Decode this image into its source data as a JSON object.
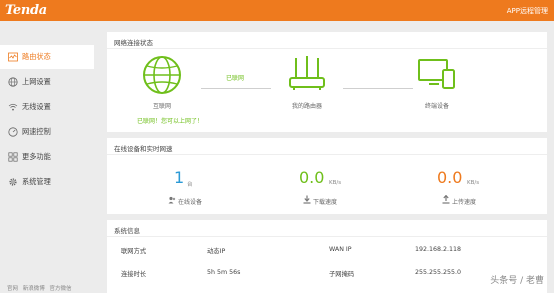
{
  "header": {
    "logo": "Tenda",
    "app_link": "APP远程管理"
  },
  "sidebar": {
    "items": [
      {
        "label": "路由状态",
        "icon": "wave-icon",
        "active": true
      },
      {
        "label": "上网设置",
        "icon": "globe-icon",
        "active": false
      },
      {
        "label": "无线设置",
        "icon": "wifi-icon",
        "active": false
      },
      {
        "label": "网速控制",
        "icon": "gauge-icon",
        "active": false
      },
      {
        "label": "更多功能",
        "icon": "grid-icon",
        "active": false
      },
      {
        "label": "系统管理",
        "icon": "gear-icon",
        "active": false
      }
    ],
    "footer": [
      "官网",
      "新浪微博",
      "官方微信"
    ]
  },
  "connection": {
    "title": "网络连接状态",
    "internet_label": "互联网",
    "link_status": "已联网",
    "router_label": "我的路由器",
    "device_label": "终端设备",
    "message": "已联网！您可以上网了！",
    "accent_green": "#6fbf1b"
  },
  "speed": {
    "title": "在线设备和实时网速",
    "devices": {
      "value": "1",
      "unit": "台",
      "label": "在线设备"
    },
    "download": {
      "value": "0.0",
      "unit": "KB/s",
      "label": "下载速度"
    },
    "upload": {
      "value": "0.0",
      "unit": "KB/s",
      "label": "上传速度"
    },
    "colors": {
      "blue": "#2b9ad6",
      "green": "#6fbf1b",
      "orange": "#ee7a1e"
    }
  },
  "system": {
    "title": "系统信息",
    "rows": [
      {
        "k1": "联网方式",
        "v1": "动态IP",
        "k2": "WAN IP",
        "v2": "192.168.2.118"
      },
      {
        "k1": "连接时长",
        "v1": "5h 5m 56s",
        "k2": "子网掩码",
        "v2": "255.255.255.0"
      }
    ]
  },
  "watermark": "头条号 / 老曹"
}
